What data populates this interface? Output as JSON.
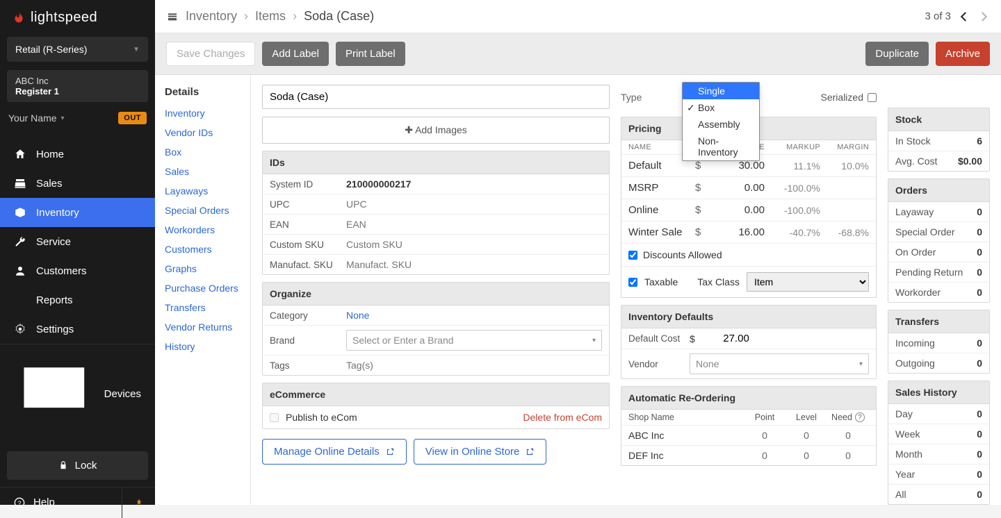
{
  "logo_text": "lightspeed",
  "shop_selector": "Retail (R-Series)",
  "shop_name": "ABC Inc",
  "register": "Register 1",
  "user_name": "Your Name",
  "out_badge": "OUT",
  "nav": {
    "home": "Home",
    "sales": "Sales",
    "inventory": "Inventory",
    "service": "Service",
    "customers": "Customers",
    "reports": "Reports",
    "settings": "Settings",
    "devices": "Devices",
    "lock": "Lock",
    "help": "Help"
  },
  "breadcrumb": {
    "a": "Inventory",
    "b": "Items",
    "c": "Soda (Case)"
  },
  "pager_text": "3 of 3",
  "buttons": {
    "save": "Save Changes",
    "add_label": "Add Label",
    "print_label": "Print Label",
    "duplicate": "Duplicate",
    "archive": "Archive",
    "manage_online": "Manage Online Details",
    "view_store": "View in Online Store"
  },
  "subnav": {
    "head": "Details",
    "items": {
      "inventory": "Inventory",
      "vendor_ids": "Vendor IDs",
      "box": "Box",
      "sales": "Sales",
      "layaways": "Layaways",
      "special_orders": "Special Orders",
      "workorders": "Workorders",
      "customers": "Customers",
      "graphs": "Graphs",
      "purchase_orders": "Purchase Orders",
      "transfers": "Transfers",
      "vendor_returns": "Vendor Returns",
      "history": "History"
    }
  },
  "item_name": "Soda (Case)",
  "type_label": "Type",
  "type_options": {
    "single": "Single",
    "box": "Box",
    "assembly": "Assembly",
    "noninv": "Non-Inventory"
  },
  "serialized_label": "Serialized",
  "add_images": "Add Images",
  "ids": {
    "head": "IDs",
    "system_id_k": "System ID",
    "system_id_v": "210000000217",
    "upc_k": "UPC",
    "upc_ph": "UPC",
    "ean_k": "EAN",
    "ean_ph": "EAN",
    "csku_k": "Custom SKU",
    "csku_ph": "Custom SKU",
    "msku_k": "Manufact. SKU",
    "msku_ph": "Manufact. SKU"
  },
  "organize": {
    "head": "Organize",
    "cat_k": "Category",
    "cat_v": "None",
    "brand_k": "Brand",
    "brand_ph": "Select or Enter a Brand",
    "tags_k": "Tags",
    "tags_ph": "Tag(s)"
  },
  "ecom": {
    "head": "eCommerce",
    "publish": "Publish to eCom",
    "delete": "Delete from eCom"
  },
  "pricing": {
    "head": "Pricing",
    "cols": {
      "name": "NAME",
      "price": "PRICE",
      "markup": "MARKUP",
      "margin": "MARGIN"
    },
    "rows": {
      "default": {
        "name": "Default",
        "price": "30.00",
        "markup": "11.1%",
        "margin": "10.0%"
      },
      "msrp": {
        "name": "MSRP",
        "price": "0.00",
        "markup": "-100.0%",
        "margin": ""
      },
      "online": {
        "name": "Online",
        "price": "0.00",
        "markup": "-100.0%",
        "margin": ""
      },
      "winter": {
        "name": "Winter Sale",
        "price": "16.00",
        "markup": "-40.7%",
        "margin": "-68.8%"
      }
    },
    "discounts": "Discounts Allowed",
    "taxable": "Taxable",
    "taxclass_lbl": "Tax Class",
    "taxclass_val": "Item"
  },
  "invdef": {
    "head": "Inventory Defaults",
    "cost_k": "Default Cost",
    "cost_v": "27.00",
    "vendor_k": "Vendor",
    "vendor_v": "None"
  },
  "reorder": {
    "head": "Automatic Re-Ordering",
    "cols": {
      "shop": "Shop Name",
      "point": "Point",
      "level": "Level",
      "need": "Need"
    },
    "rows": {
      "abc": {
        "name": "ABC Inc",
        "point": "0",
        "level": "0",
        "need": "0"
      },
      "def": {
        "name": "DEF Inc",
        "point": "0",
        "level": "0",
        "need": "0"
      }
    }
  },
  "stock": {
    "head": "Stock",
    "instock_k": "In Stock",
    "instock_v": "6",
    "avgcost_k": "Avg. Cost",
    "avgcost_v": "$0.00"
  },
  "orders": {
    "head": "Orders",
    "layaway_k": "Layaway",
    "layaway_v": "0",
    "special_k": "Special Order",
    "special_v": "0",
    "onorder_k": "On Order",
    "onorder_v": "0",
    "pending_k": "Pending Return",
    "pending_v": "0",
    "workorder_k": "Workorder",
    "workorder_v": "0"
  },
  "transfers": {
    "head": "Transfers",
    "in_k": "Incoming",
    "in_v": "0",
    "out_k": "Outgoing",
    "out_v": "0"
  },
  "sales_history": {
    "head": "Sales History",
    "day_k": "Day",
    "day_v": "0",
    "week_k": "Week",
    "week_v": "0",
    "month_k": "Month",
    "month_v": "0",
    "year_k": "Year",
    "year_v": "0",
    "all_k": "All",
    "all_v": "0"
  }
}
